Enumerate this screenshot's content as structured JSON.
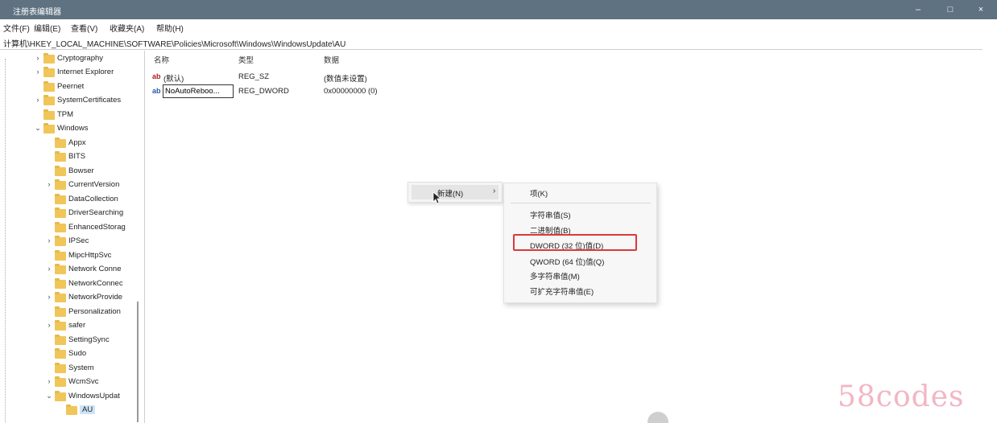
{
  "window": {
    "title": "注册表编辑器",
    "controls": {
      "minimize": "–",
      "maximize": "□",
      "close": "×"
    }
  },
  "menu": [
    "文件(F)",
    "编辑(E)",
    "查看(V)",
    "收藏夹(A)",
    "帮助(H)"
  ],
  "address": "计算机\\HKEY_LOCAL_MACHINE\\SOFTWARE\\Policies\\Microsoft\\Windows\\WindowsUpdate\\AU",
  "tree": [
    {
      "label": "Cryptography",
      "arrow": "›"
    },
    {
      "label": "Internet Explorer",
      "arrow": "›"
    },
    {
      "label": "Peernet",
      "arrow": ""
    },
    {
      "label": "SystemCertificates",
      "arrow": "›"
    },
    {
      "label": "TPM",
      "arrow": ""
    },
    {
      "label": "Windows",
      "arrow": "⌄"
    },
    {
      "label": "Appx",
      "arrow": ""
    },
    {
      "label": "BITS",
      "arrow": ""
    },
    {
      "label": "Bowser",
      "arrow": ""
    },
    {
      "label": "CurrentVersion",
      "arrow": "›"
    },
    {
      "label": "DataCollection",
      "arrow": ""
    },
    {
      "label": "DriverSearching",
      "arrow": ""
    },
    {
      "label": "EnhancedStorag",
      "arrow": ""
    },
    {
      "label": "IPSec",
      "arrow": "›"
    },
    {
      "label": "MipcHttpSvc",
      "arrow": ""
    },
    {
      "label": "Network Conne",
      "arrow": "›"
    },
    {
      "label": "NetworkConnec",
      "arrow": ""
    },
    {
      "label": "NetworkProvide",
      "arrow": "›"
    },
    {
      "label": "Personalization",
      "arrow": ""
    },
    {
      "label": "safer",
      "arrow": "›"
    },
    {
      "label": "SettingSync",
      "arrow": ""
    },
    {
      "label": "Sudo",
      "arrow": ""
    },
    {
      "label": "System",
      "arrow": ""
    },
    {
      "label": "WcmSvc",
      "arrow": "›"
    },
    {
      "label": "WindowsUpdat",
      "arrow": "⌄"
    },
    {
      "label": "AU",
      "arrow": ""
    }
  ],
  "list": {
    "columns": {
      "name": "名称",
      "type": "类型",
      "data": "数据"
    },
    "rows": [
      {
        "icon": "ab",
        "name": "(默认)",
        "type": "REG_SZ",
        "data": "(数值未设置)"
      },
      {
        "icon": "ab",
        "name": "NoAutoReboo...",
        "type": "REG_DWORD",
        "data": "0x00000000 (0)"
      }
    ]
  },
  "context_menu": {
    "new_label": "新建(N)",
    "chevron": "›"
  },
  "submenu": {
    "items": [
      "项(K)",
      "字符串值(S)",
      "二进制值(B)",
      "DWORD (32 位)值(D)",
      "QWORD (64 位)值(Q)",
      "多字符串值(M)",
      "可扩充字符串值(E)"
    ]
  },
  "watermark": "58codes"
}
